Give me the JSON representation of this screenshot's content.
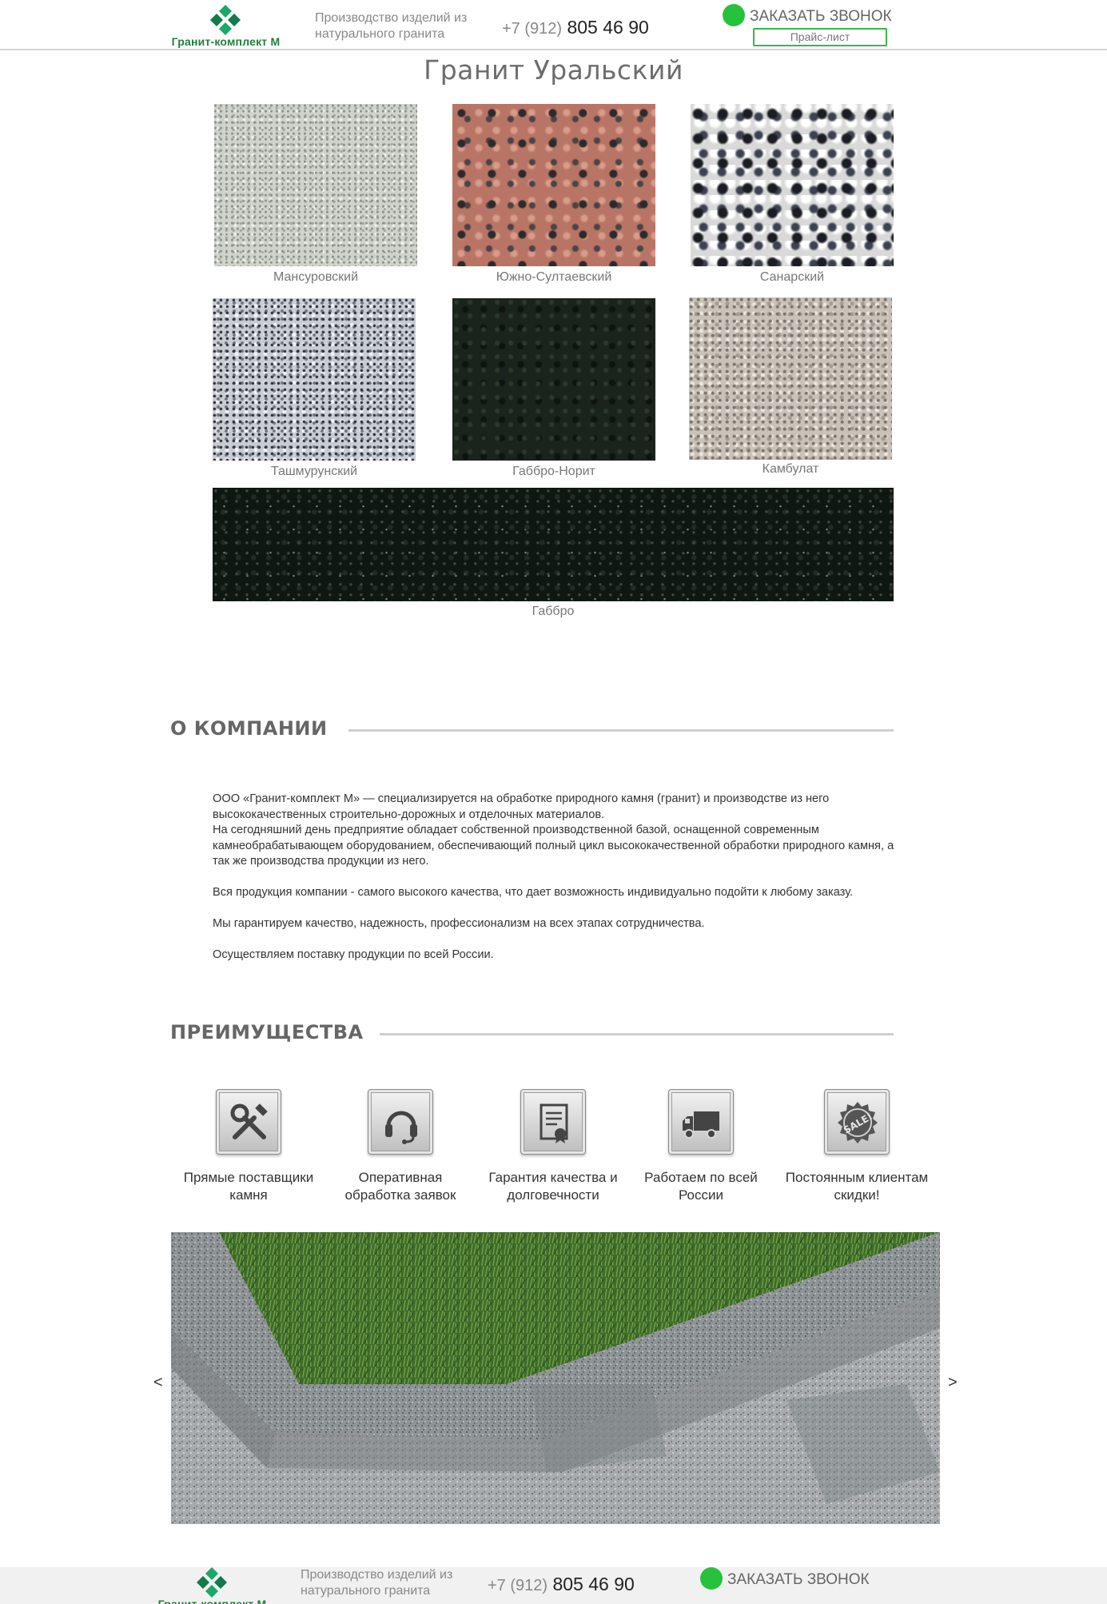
{
  "header": {
    "logo_text": "Гранит-комплект М",
    "tagline": "Производство изделий из натурального гранита",
    "phone_code": "+7 (912)",
    "phone_number": "805 46 90",
    "callback_label": "ЗАКАЗАТЬ ЗВОНОК",
    "price_list_label": "Прайс-лист",
    "accent_color": "#26c23b",
    "brand_color": "#1d7f3e"
  },
  "catalog": {
    "title": "Гранит Уральский",
    "items": [
      {
        "name": "Мансуровский",
        "texture": "light-speckled-granite"
      },
      {
        "name": "Южно-Султаевский",
        "texture": "pink-granite"
      },
      {
        "name": "Санарский",
        "texture": "black-white-granite"
      },
      {
        "name": "Ташмурунский",
        "texture": "grey-granite"
      },
      {
        "name": "Габбро-Норит",
        "texture": "dark-green-granite"
      },
      {
        "name": "Камбулат",
        "texture": "beige-granite"
      },
      {
        "name": "Габбро",
        "texture": "black-gabbro"
      }
    ]
  },
  "about": {
    "heading": "О КОМПАНИИ",
    "paragraphs": [
      "ООО «Гранит-комплект М» — специализируется на обработке природного камня (гранит) и производстве из него высококачественных строительно-дорожных и отделочных материалов.",
      "На сегодняшний день предприятие обладает собственной производственной базой, оснащенной современным камнеобрабатывающем оборудованием, обеспечивающий полный цикл высококачественной обработки природного камня, а так же производства продукции из него.",
      "Вся продукция компании - самого высокого качества, что дает возможность индивидуально подойти к любому заказу.",
      "Мы гарантируем качество, надежность, профессионализм на всех этапах сотрудничества.",
      "Осуществляем поставку продукции по всей России."
    ]
  },
  "advantages": {
    "heading": "ПРЕИМУЩЕСТВА",
    "items": [
      {
        "label": "Прямые поставщики камня",
        "icon": "tools-icon"
      },
      {
        "label": "Оперативная обработка заявок",
        "icon": "headset-icon"
      },
      {
        "label": "Гарантия качества и долговечности",
        "icon": "certificate-icon"
      },
      {
        "label": "Работаем по всей России",
        "icon": "truck-icon"
      },
      {
        "label": "Постоянным клиентам скидки!",
        "icon": "sale-badge-icon"
      }
    ]
  },
  "slider": {
    "prev_label": "<",
    "next_label": ">",
    "image": "granite-curb-with-grass"
  },
  "footer": {
    "logo_text": "Гранит-комплект М",
    "tagline": "Производство изделий из натурального гранита",
    "phone_code": "+7 (912)",
    "phone_number": "805 46 90",
    "callback_label": "ЗАКАЗАТЬ ЗВОНОК"
  }
}
